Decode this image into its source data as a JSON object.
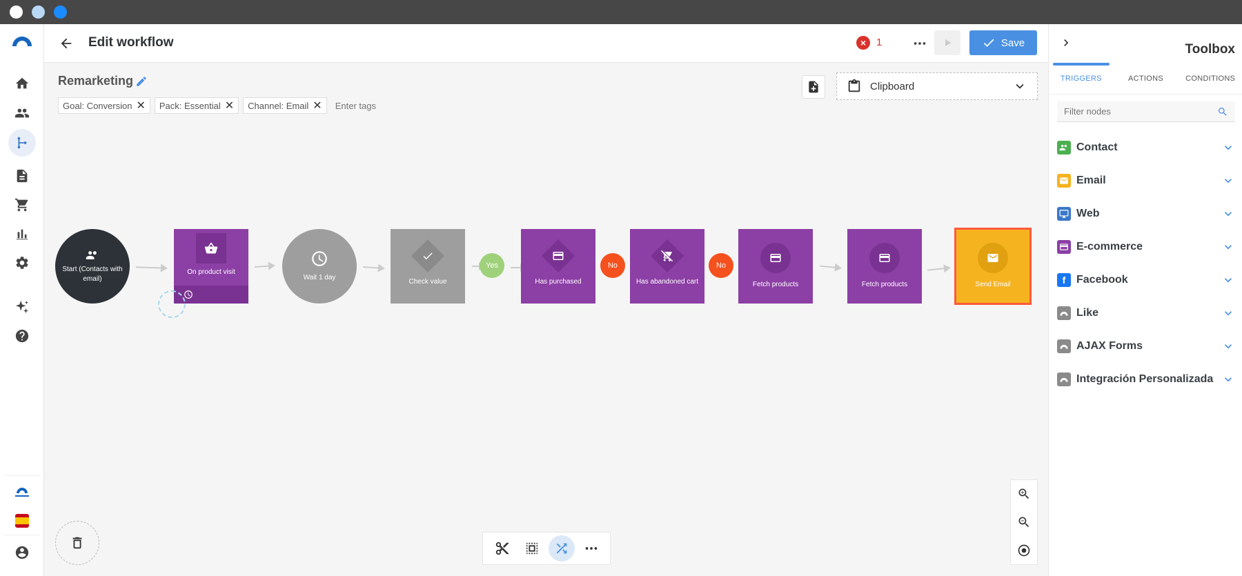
{
  "window": {
    "dots": [
      "#ffffff",
      "#b8d8f5",
      "#1a8cff"
    ]
  },
  "sidebar": {
    "items": [
      {
        "icon": "home-icon"
      },
      {
        "icon": "contacts-icon"
      },
      {
        "icon": "workflow-icon",
        "active": true
      },
      {
        "icon": "document-icon"
      },
      {
        "icon": "cart-icon"
      },
      {
        "icon": "chart-icon"
      },
      {
        "icon": "gear-icon"
      },
      {
        "icon": "sparkle-icon"
      },
      {
        "icon": "help-icon"
      }
    ],
    "bottom": [
      "brand-logo",
      "spain-flag-icon",
      "user-account-icon"
    ]
  },
  "header": {
    "title": "Edit workflow",
    "error_count": "1",
    "save_label": "Save"
  },
  "workflow": {
    "name": "Remarketing",
    "tags": [
      {
        "label": "Goal: Conversion"
      },
      {
        "label": "Pack: Essential"
      },
      {
        "label": "Channel: Email"
      }
    ],
    "tags_placeholder": "Enter tags",
    "clipboard_label": "Clipboard"
  },
  "nodes": [
    {
      "label": "Start (Contacts with email)",
      "type": "start",
      "color": "#2d3238"
    },
    {
      "label": "On product visit",
      "type": "trigger",
      "color": "#8c3fa5"
    },
    {
      "label": "Wait 1 day",
      "type": "wait",
      "color": "#9e9e9e"
    },
    {
      "label": "Check value",
      "type": "condition",
      "color": "#9e9e9e"
    },
    {
      "label": "Has purchased",
      "type": "condition",
      "color": "#8c3fa5"
    },
    {
      "label": "Has abandoned cart",
      "type": "condition",
      "color": "#8c3fa5"
    },
    {
      "label": "Fetch products",
      "type": "action",
      "color": "#8c3fa5"
    },
    {
      "label": "Fetch products",
      "type": "action",
      "color": "#8c3fa5"
    },
    {
      "label": "Send Email",
      "type": "action",
      "color": "#f5b320"
    }
  ],
  "connectors": [
    {
      "label": "Yes",
      "color": "#9ed17a"
    },
    {
      "label": "No",
      "color": "#f4511e"
    },
    {
      "label": "No",
      "color": "#f4511e"
    }
  ],
  "toolbox": {
    "title": "Toolbox",
    "tabs": [
      {
        "label": "TRIGGERS",
        "active": true
      },
      {
        "label": "ACTIONS"
      },
      {
        "label": "CONDITIONS"
      }
    ],
    "filter_placeholder": "Filter nodes",
    "categories": [
      {
        "label": "Contact",
        "color": "#4caf50",
        "icon": "contacts-icon"
      },
      {
        "label": "Email",
        "color": "#f5b320",
        "icon": "mail-icon"
      },
      {
        "label": "Web",
        "color": "#3a78c9",
        "icon": "monitor-icon"
      },
      {
        "label": "E-commerce",
        "color": "#8c3fa5",
        "icon": "card-icon"
      },
      {
        "label": "Facebook",
        "color": "#1877f2",
        "icon": "facebook-icon"
      },
      {
        "label": "Like",
        "color": "#8a8a8a",
        "icon": "brand-icon"
      },
      {
        "label": "AJAX Forms",
        "color": "#8a8a8a",
        "icon": "brand-icon"
      },
      {
        "label": "Integración Personalizada",
        "color": "#8a8a8a",
        "icon": "brand-icon"
      }
    ]
  }
}
